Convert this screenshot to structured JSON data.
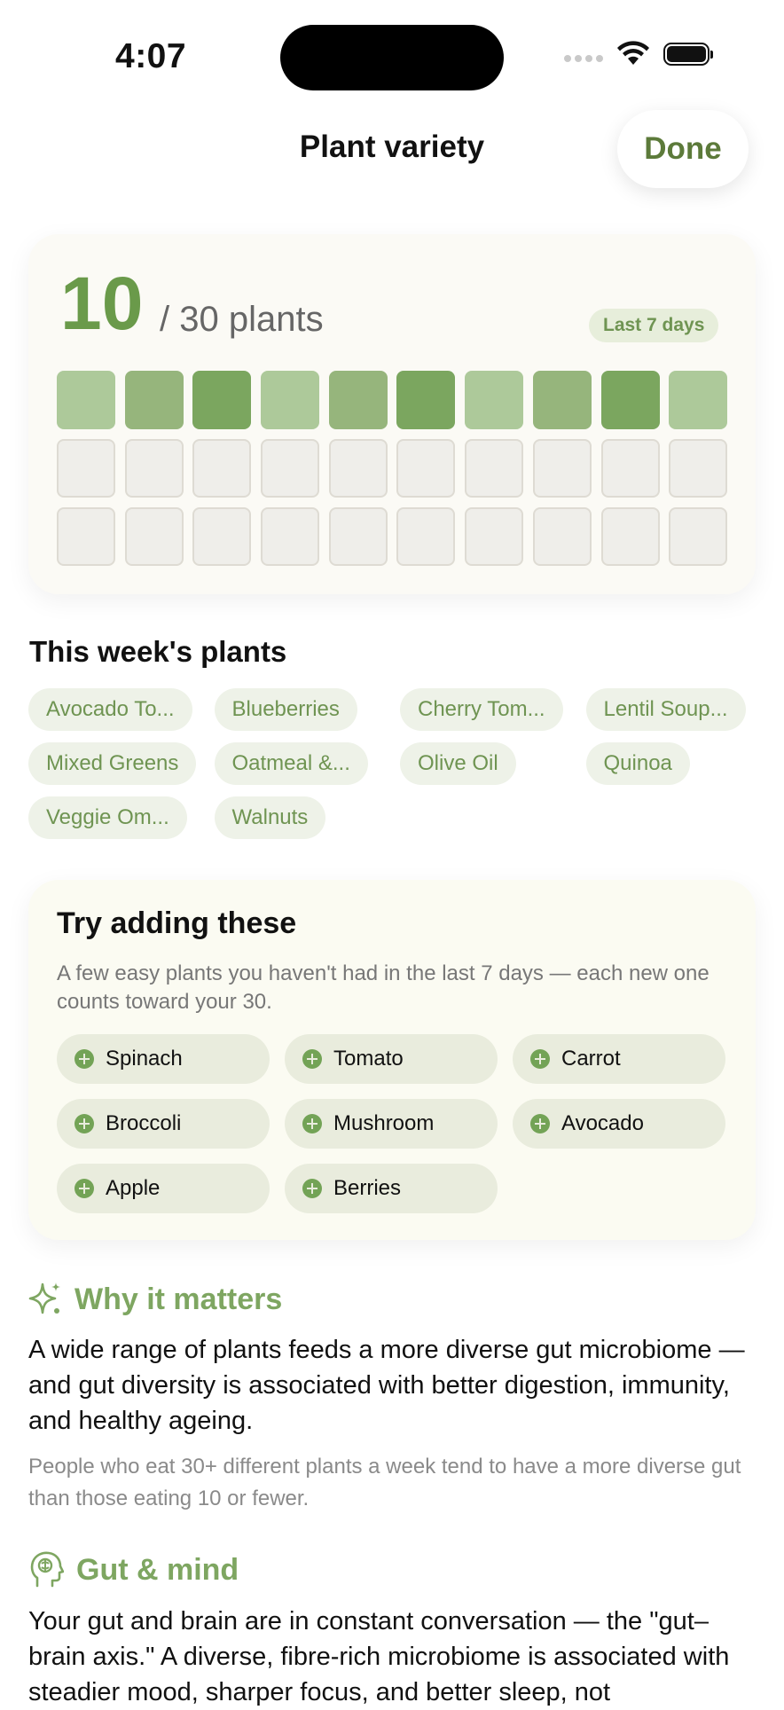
{
  "status_bar": {
    "time": "4:07"
  },
  "nav": {
    "title": "Plant variety",
    "done_label": "Done"
  },
  "summary": {
    "count": "10",
    "goal_text": "/ 30 plants",
    "count_value": 10,
    "goal_value": 30,
    "period": "Last 7 days",
    "grid_filled_shades": [
      "light",
      "mid",
      "dark",
      "light",
      "mid",
      "dark",
      "light",
      "mid",
      "dark",
      "light"
    ],
    "colors": {
      "light": "#adc99a",
      "mid": "#96b57c",
      "dark": "#7ba65f",
      "empty": "#efeeea"
    }
  },
  "week_section": {
    "title": "This week's plants",
    "chips": [
      "Avocado To...",
      "Blueberries",
      "Cherry Tom...",
      "Lentil Soup...",
      "Mixed Greens",
      "Oatmeal &...",
      "Olive Oil",
      "Quinoa",
      "Veggie Om...",
      "Walnuts"
    ]
  },
  "suggestions": {
    "title": "Try adding these",
    "subtitle": "A few easy plants you haven't had in the last 7 days — each new one counts toward your 30.",
    "items": [
      "Spinach",
      "Tomato",
      "Carrot",
      "Broccoli",
      "Mushroom",
      "Avocado",
      "Apple",
      "Berries"
    ],
    "icon": "plus-circle-icon"
  },
  "why": {
    "icon": "sparkles-icon",
    "title": "Why it matters",
    "body": "A wide range of plants feeds a more diverse gut microbiome — and gut diversity is associated with better digestion, immunity, and healthy ageing.",
    "note": "People who eat 30+ different plants a week tend to have a more diverse gut than those eating 10 or fewer."
  },
  "gut_mind": {
    "icon": "brain-head-icon",
    "title": "Gut & mind",
    "body": "Your gut and brain are in constant conversation — the \"gut–brain axis.\" A diverse, fibre-rich microbiome is associated with steadier mood, sharper focus, and better sleep, not"
  },
  "theme": {
    "accent": "#6a9a4a",
    "accent_soft": "#7ea661",
    "chip_bg": "#eef2e8"
  }
}
